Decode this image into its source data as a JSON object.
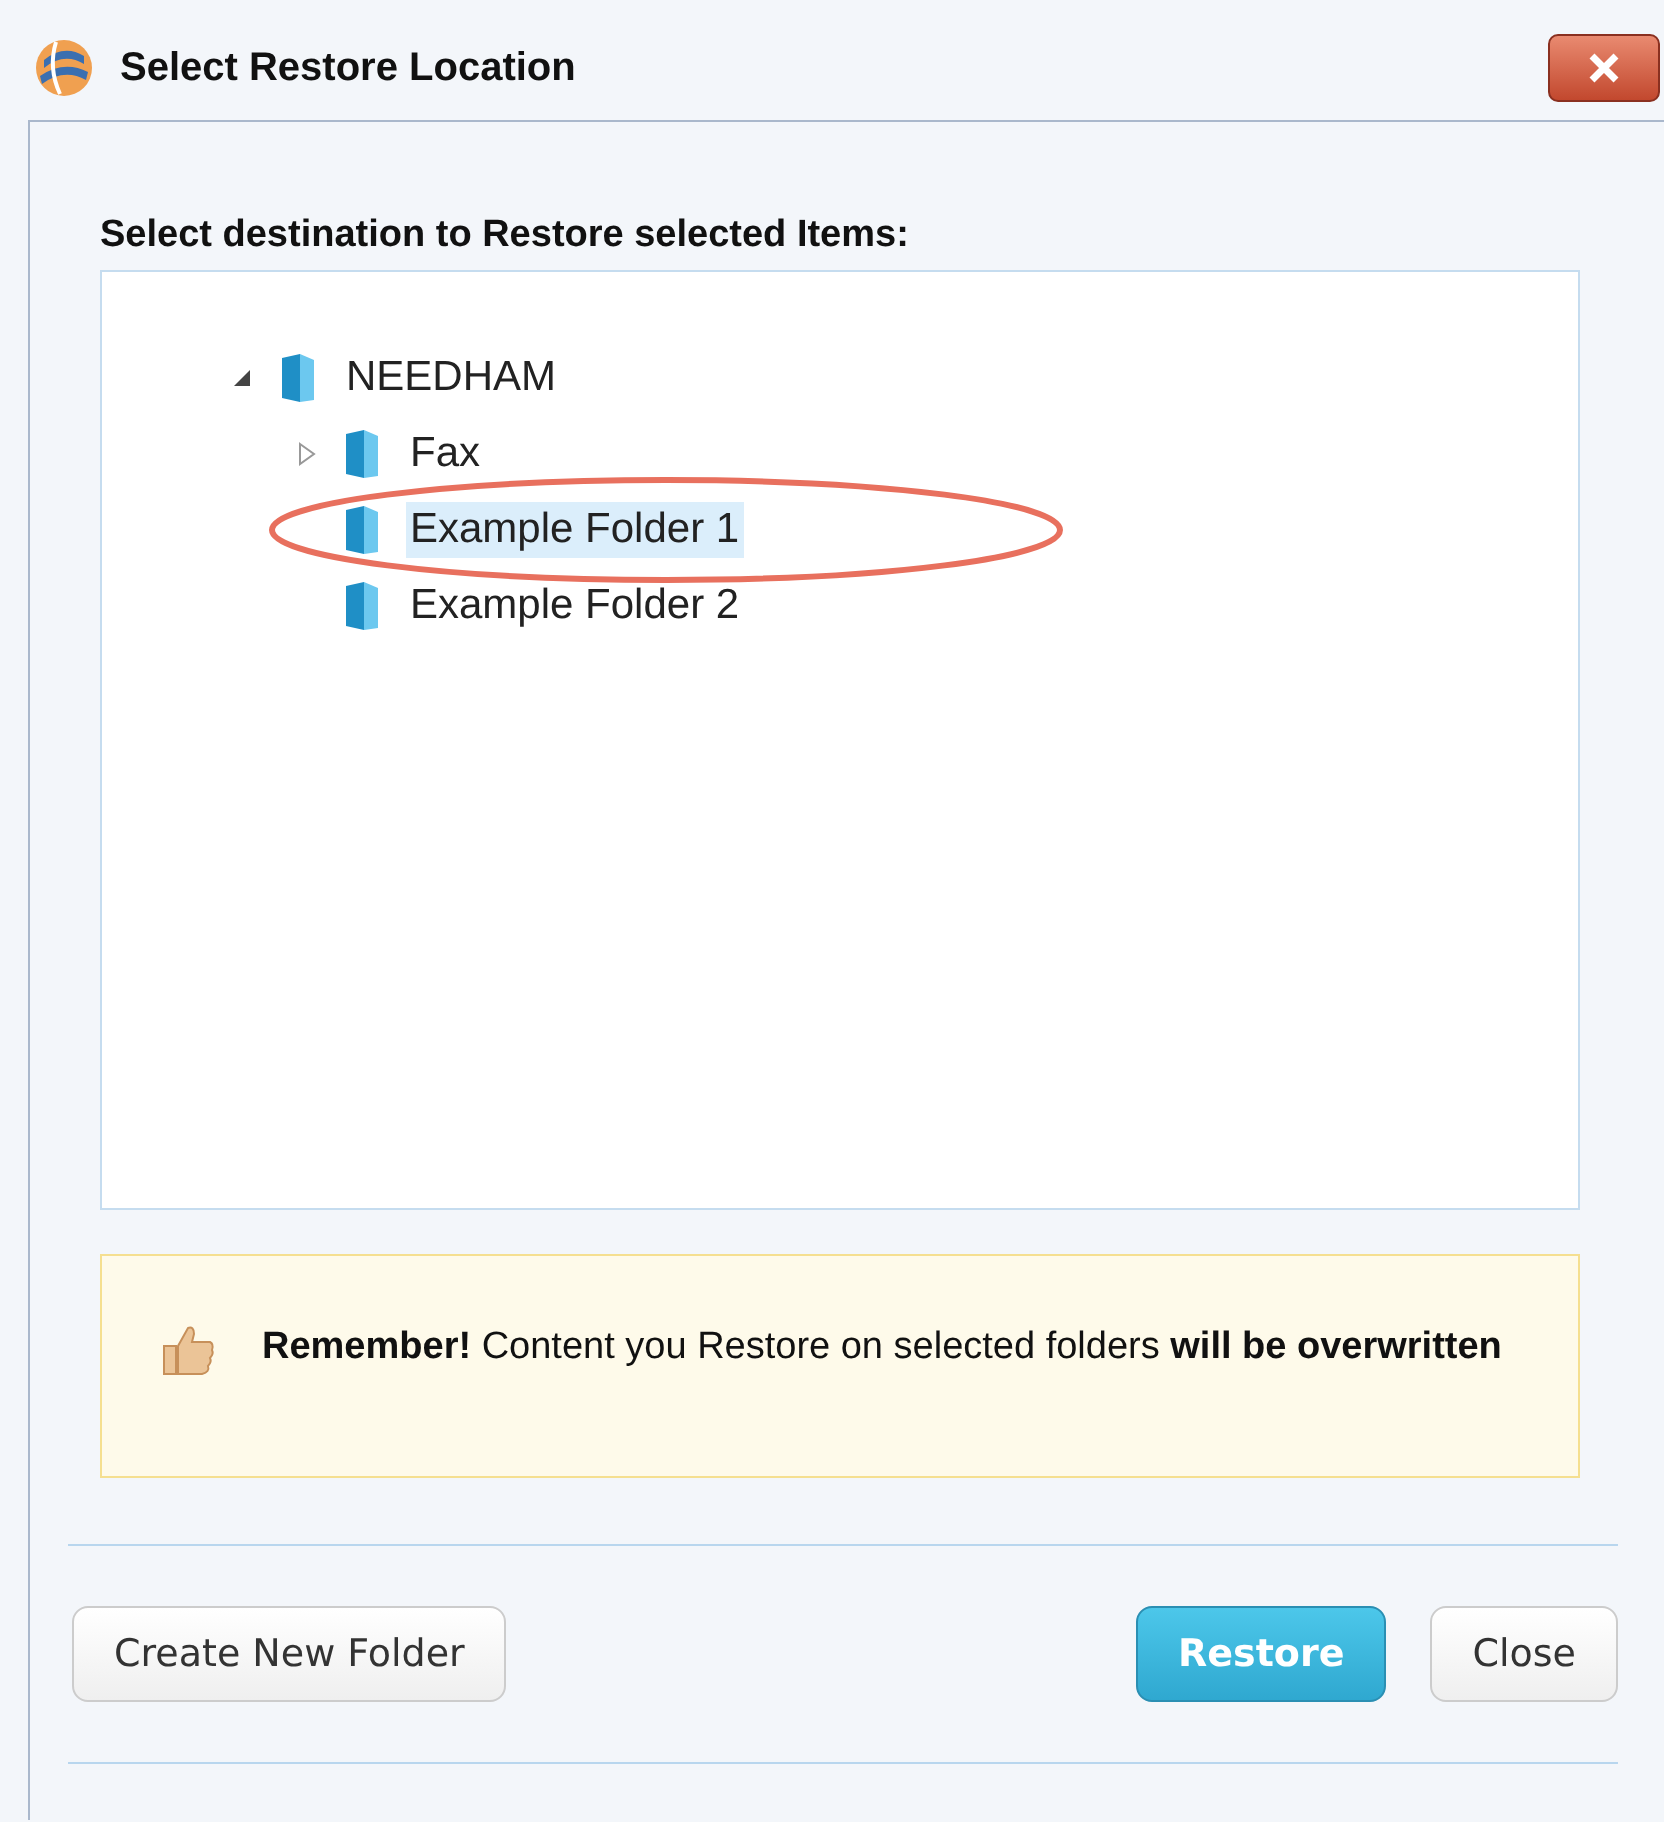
{
  "window": {
    "title": "Select Restore Location"
  },
  "heading": "Select destination to Restore selected Items:",
  "tree": [
    {
      "label": "NEEDHAM",
      "expanded": true,
      "selected": false,
      "children": [
        {
          "label": "Fax",
          "expanded": false,
          "selected": false
        },
        {
          "label": "Example Folder 1",
          "selected": true
        },
        {
          "label": "Example Folder 2",
          "selected": false
        }
      ]
    }
  ],
  "notice": "**Remember!** Content you Restore on selected folders **will be overwritten**",
  "buttons": [
    {
      "label": "Create New Folder",
      "kind": "secondary"
    },
    {
      "label": "Restore",
      "kind": "primary"
    },
    {
      "label": "Close",
      "kind": "secondary"
    }
  ]
}
